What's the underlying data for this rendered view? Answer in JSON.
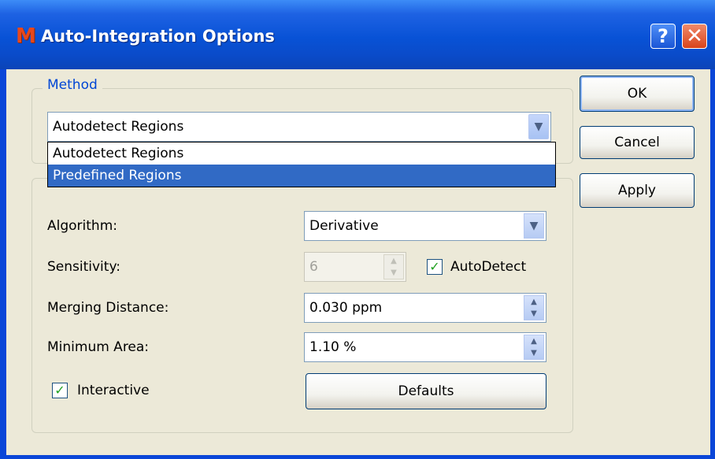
{
  "window": {
    "title": "Auto-Integration Options",
    "app_icon": "M",
    "help_label": "?",
    "close_label": "✕"
  },
  "method": {
    "legend": "Method",
    "selected": "Autodetect Regions",
    "options": [
      "Autodetect Regions",
      "Predefined Regions"
    ],
    "highlighted_option": "Predefined Regions"
  },
  "settings": {
    "algorithm_label": "Algorithm:",
    "algorithm_value": "Derivative",
    "sensitivity_label": "Sensitivity:",
    "sensitivity_value": "6",
    "autodetect_label": "AutoDetect",
    "autodetect_checked": true,
    "merging_label": "Merging Distance:",
    "merging_value": "0.030 ppm",
    "min_area_label": "Minimum Area:",
    "min_area_value": "1.10 %",
    "interactive_label": "Interactive",
    "interactive_checked": true,
    "defaults_label": "Defaults"
  },
  "buttons": {
    "ok": "OK",
    "cancel": "Cancel",
    "apply": "Apply"
  },
  "colors": {
    "titlebar": "#0852d6",
    "dialog_bg": "#ece9d8",
    "legend": "#0046d5",
    "selection": "#316ac5",
    "close_button": "#d8441c"
  },
  "icons": {
    "app": "app-logo-icon",
    "help": "help-icon",
    "close": "close-icon",
    "dropdown": "chevron-down-icon",
    "spin": "spin-arrows-icon",
    "check": "checkmark-icon"
  }
}
